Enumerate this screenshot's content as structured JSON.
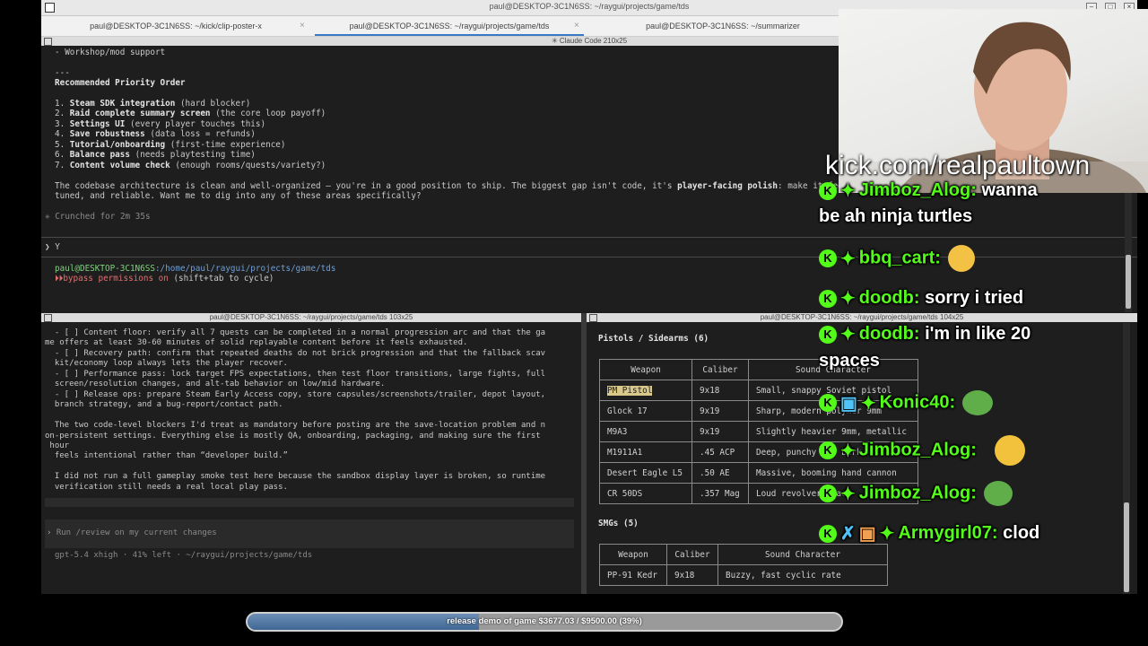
{
  "window": {
    "title": "paul@DESKTOP-3C1N6SS: ~/raygui/projects/game/tds",
    "tabs": [
      {
        "label": "paul@DESKTOP-3C1N6SS: ~/kick/clip-poster-x"
      },
      {
        "label": "paul@DESKTOP-3C1N6SS: ~/raygui/projects/game/tds"
      },
      {
        "label": "paul@DESKTOP-3C1N6SS: ~/summarizer"
      }
    ],
    "active_tab": 1
  },
  "top_pane": {
    "header": "✳ Claude Code 210x25",
    "lines": {
      "l1": "- Workshop/mod support",
      "l2": "---",
      "l3": "Recommended Priority Order",
      "p1n": "1. ",
      "p1b": "Steam SDK integration",
      "p1r": " (hard blocker)",
      "p2n": "2. ",
      "p2b": "Raid complete summary screen",
      "p2r": " (the core loop payoff)",
      "p3n": "3. ",
      "p3b": "Settings UI",
      "p3r": " (every player touches this)",
      "p4n": "4. ",
      "p4b": "Save robustness",
      "p4r": " (data loss = refunds)",
      "p5n": "5. ",
      "p5b": "Tutorial/onboarding",
      "p5r": " (first-time experience)",
      "p6n": "6. ",
      "p6b": "Balance pass",
      "p6r": " (needs playtesting time)",
      "p7n": "7. ",
      "p7b": "Content volume check",
      "p7r": " (enough rooms/quests/variety?)",
      "sum1a": "The codebase architecture is clean and well-organized — you're in a good position to ship. The biggest gap isn't code, it's ",
      "sum1b": "player-facing polish",
      "sum1c": ": make it feel",
      "sum2": "tuned, and reliable. Want me to dig into any of these areas specifically?",
      "crunch": "✳ Crunched for 2m 35s",
      "prompt": "❯ Y",
      "host": "paul@DESKTOP-3C1N6SS",
      "path": ":/home/paul/raygui/projects/game/tds",
      "bypass_icon": "⏵⏵",
      "bypass_a": "bypass permissions on",
      "bypass_b": " (shift+tab to cycle)"
    }
  },
  "left_pane": {
    "header": "paul@DESKTOP-3C1N6SS: ~/raygui/projects/game/tds 103x25",
    "lines": [
      "  - [ ] Content floor: verify all 7 quests can be completed in a normal progression arc and that the ga",
      "me offers at least 30-60 minutes of solid replayable content before it feels exhausted.",
      "  - [ ] Recovery path: confirm that repeated deaths do not brick progression and that the fallback scav",
      "  kit/economy loop always lets the player recover.",
      "  - [ ] Performance pass: lock target FPS expectations, then test floor transitions, large fights, full",
      "  screen/resolution changes, and alt-tab behavior on low/mid hardware.",
      "  - [ ] Release ops: prepare Steam Early Access copy, store capsules/screenshots/trailer, depot layout,",
      "  branch strategy, and a bug-report/contact path.",
      "",
      "  The two code-level blockers I'd treat as mandatory before posting are the save-location problem and n",
      "on-persistent settings. Everything else is mostly QA, onboarding, packaging, and making sure the first",
      " hour",
      "  feels intentional rather than “developer build.”",
      "",
      "  I did not run a full gameplay smoke test here because the sandbox display layer is broken, so runtime",
      "  verification still needs a real local play pass."
    ],
    "input_placeholder": "Run /review on my current changes",
    "status": "gpt-5.4 xhigh · 41% left · ~/raygui/projects/game/tds"
  },
  "right_pane": {
    "header": "paul@DESKTOP-3C1N6SS: ~/raygui/projects/game/tds 104x25",
    "pistols_title": "Pistols / Sidearms (6)",
    "columns": [
      "Weapon",
      "Caliber",
      "Sound Character"
    ],
    "pistols": [
      [
        "PM Pistol",
        "9x18",
        "Small, snappy Soviet pistol"
      ],
      [
        "Glock 17",
        "9x19",
        "Sharp, modern polymer 9mm"
      ],
      [
        "M9A3",
        "9x19",
        "Slightly heavier 9mm, metallic"
      ],
      [
        "M1911A1",
        ".45 ACP",
        "Deep, punchy .45 bark"
      ],
      [
        "Desert Eagle L5",
        ".50 AE",
        "Massive, booming hand cannon"
      ],
      [
        "CR 50DS",
        ".357 Mag",
        "Loud revolver crack"
      ]
    ],
    "smgs_title": "SMGs (5)",
    "smgs": [
      [
        "PP-91 Kedr",
        "9x18",
        "Buzzy, fast cyclic rate"
      ]
    ]
  },
  "stream": {
    "url": "kick.com/realpaultown",
    "chat": [
      {
        "user": "Jimboz_Alog:",
        "text": "wanna"
      },
      {
        "user": "",
        "text": "be ah ninja turtles"
      },
      {
        "user": "bbq_cart:",
        "text": ""
      },
      {
        "user": "doodb:",
        "text": "sorry i tried"
      },
      {
        "user": "doodb:",
        "text": "i'm in like 20"
      },
      {
        "user": "",
        "text": "spaces"
      },
      {
        "user": "Konic40:",
        "text": ""
      },
      {
        "user": "Jimboz_Alog:",
        "text": ""
      },
      {
        "user": "Jimboz_Alog:",
        "text": ""
      },
      {
        "user": "Armygirl07:",
        "text": "clod"
      }
    ],
    "goal": {
      "label": "release demo of game $3677.03 / $9500.00 (39%)",
      "fraction": 0.39
    },
    "colors": {
      "kick_green": "#53fc18"
    }
  }
}
